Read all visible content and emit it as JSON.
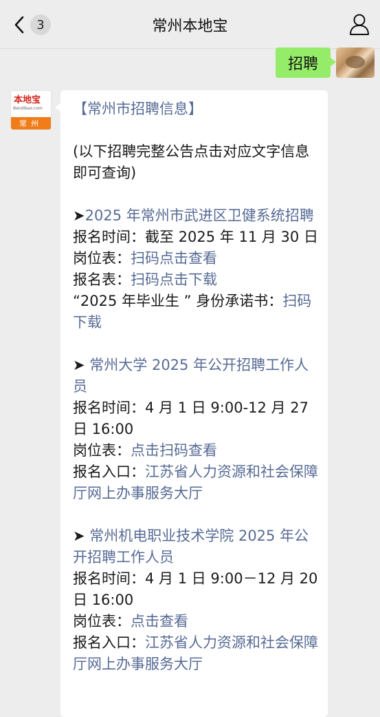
{
  "nav": {
    "back_badge": "3",
    "title": "常州本地宝"
  },
  "outgoing": {
    "text": "招聘"
  },
  "bot": {
    "logo_text": "本地宝",
    "logo_sub": "Bendibao.com",
    "city": "常州"
  },
  "message": {
    "header": "【常州市招聘信息】",
    "intro": "(以下招聘完整公告点击对应文字信息即可查询)",
    "arrow": "➤",
    "jobs": [
      {
        "title": "2025 年常州市武进区卫健系统招聘",
        "time_label": "报名时间：",
        "time_value": "截至 2025 年 11 月 30 日",
        "post_label": "岗位表：",
        "post_link": "扫码点击查看",
        "form_label": "报名表：",
        "form_link": "扫码点击下载",
        "promise_label": "“2025 年毕业生 ” 身份承诺书：",
        "promise_link": "扫码下载"
      },
      {
        "title": " 常州大学 2025 年公开招聘工作人员",
        "time_label": "报名时间：",
        "time_value": "4 月 1 日 9:00-12 月 27 日 16:00",
        "post_label": "岗位表：",
        "post_link": "点击扫码查看",
        "entry_label": "报名入口：",
        "entry_link": "江苏省人力资源和社会保障厅网上办事服务大厅"
      },
      {
        "title": " 常州机电职业技术学院 2025 年公开招聘工作人员",
        "time_label": "报名时间：",
        "time_value": "4 月 1 日 9:00－12 月 20 日 16:00",
        "post_label": "岗位表：",
        "post_link": "点击查看",
        "entry_label": "报名入口：",
        "entry_link": "江苏省人力资源和社会保障厅网上办事服务大厅"
      }
    ]
  }
}
